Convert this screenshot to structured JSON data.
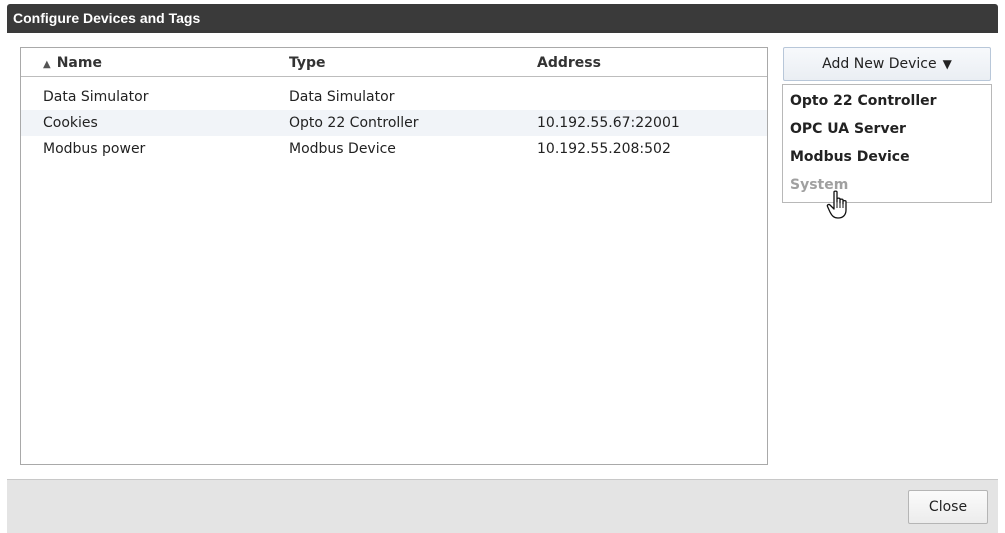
{
  "window": {
    "title": "Configure Devices and Tags"
  },
  "table": {
    "sort_icon": "sort-ascending-icon",
    "columns": [
      "Name",
      "Type",
      "Address"
    ],
    "rows": [
      {
        "name": "Data Simulator",
        "type": "Data Simulator",
        "address": ""
      },
      {
        "name": "Cookies",
        "type": "Opto 22 Controller",
        "address": "10.192.55.67:22001"
      },
      {
        "name": "Modbus power",
        "type": "Modbus Device",
        "address": "10.192.55.208:502"
      }
    ]
  },
  "add_device": {
    "label": "Add New Device",
    "menu": [
      "Opto 22 Controller",
      "OPC UA Server",
      "Modbus Device",
      "System"
    ]
  },
  "footer": {
    "close_label": "Close"
  },
  "colors": {
    "titlebar": "#3a3a3a",
    "alt_row": "#f1f4f8",
    "footer": "#e4e4e4",
    "disabled": "#a0a0a0"
  }
}
